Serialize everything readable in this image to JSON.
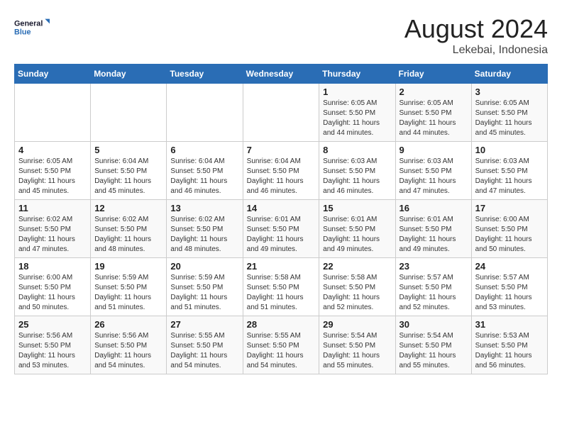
{
  "header": {
    "logo_line1": "General",
    "logo_line2": "Blue",
    "month": "August 2024",
    "location": "Lekebai, Indonesia"
  },
  "weekdays": [
    "Sunday",
    "Monday",
    "Tuesday",
    "Wednesday",
    "Thursday",
    "Friday",
    "Saturday"
  ],
  "weeks": [
    [
      {
        "day": "",
        "info": ""
      },
      {
        "day": "",
        "info": ""
      },
      {
        "day": "",
        "info": ""
      },
      {
        "day": "",
        "info": ""
      },
      {
        "day": "1",
        "info": "Sunrise: 6:05 AM\nSunset: 5:50 PM\nDaylight: 11 hours\nand 44 minutes."
      },
      {
        "day": "2",
        "info": "Sunrise: 6:05 AM\nSunset: 5:50 PM\nDaylight: 11 hours\nand 44 minutes."
      },
      {
        "day": "3",
        "info": "Sunrise: 6:05 AM\nSunset: 5:50 PM\nDaylight: 11 hours\nand 45 minutes."
      }
    ],
    [
      {
        "day": "4",
        "info": "Sunrise: 6:05 AM\nSunset: 5:50 PM\nDaylight: 11 hours\nand 45 minutes."
      },
      {
        "day": "5",
        "info": "Sunrise: 6:04 AM\nSunset: 5:50 PM\nDaylight: 11 hours\nand 45 minutes."
      },
      {
        "day": "6",
        "info": "Sunrise: 6:04 AM\nSunset: 5:50 PM\nDaylight: 11 hours\nand 46 minutes."
      },
      {
        "day": "7",
        "info": "Sunrise: 6:04 AM\nSunset: 5:50 PM\nDaylight: 11 hours\nand 46 minutes."
      },
      {
        "day": "8",
        "info": "Sunrise: 6:03 AM\nSunset: 5:50 PM\nDaylight: 11 hours\nand 46 minutes."
      },
      {
        "day": "9",
        "info": "Sunrise: 6:03 AM\nSunset: 5:50 PM\nDaylight: 11 hours\nand 47 minutes."
      },
      {
        "day": "10",
        "info": "Sunrise: 6:03 AM\nSunset: 5:50 PM\nDaylight: 11 hours\nand 47 minutes."
      }
    ],
    [
      {
        "day": "11",
        "info": "Sunrise: 6:02 AM\nSunset: 5:50 PM\nDaylight: 11 hours\nand 47 minutes."
      },
      {
        "day": "12",
        "info": "Sunrise: 6:02 AM\nSunset: 5:50 PM\nDaylight: 11 hours\nand 48 minutes."
      },
      {
        "day": "13",
        "info": "Sunrise: 6:02 AM\nSunset: 5:50 PM\nDaylight: 11 hours\nand 48 minutes."
      },
      {
        "day": "14",
        "info": "Sunrise: 6:01 AM\nSunset: 5:50 PM\nDaylight: 11 hours\nand 49 minutes."
      },
      {
        "day": "15",
        "info": "Sunrise: 6:01 AM\nSunset: 5:50 PM\nDaylight: 11 hours\nand 49 minutes."
      },
      {
        "day": "16",
        "info": "Sunrise: 6:01 AM\nSunset: 5:50 PM\nDaylight: 11 hours\nand 49 minutes."
      },
      {
        "day": "17",
        "info": "Sunrise: 6:00 AM\nSunset: 5:50 PM\nDaylight: 11 hours\nand 50 minutes."
      }
    ],
    [
      {
        "day": "18",
        "info": "Sunrise: 6:00 AM\nSunset: 5:50 PM\nDaylight: 11 hours\nand 50 minutes."
      },
      {
        "day": "19",
        "info": "Sunrise: 5:59 AM\nSunset: 5:50 PM\nDaylight: 11 hours\nand 51 minutes."
      },
      {
        "day": "20",
        "info": "Sunrise: 5:59 AM\nSunset: 5:50 PM\nDaylight: 11 hours\nand 51 minutes."
      },
      {
        "day": "21",
        "info": "Sunrise: 5:58 AM\nSunset: 5:50 PM\nDaylight: 11 hours\nand 51 minutes."
      },
      {
        "day": "22",
        "info": "Sunrise: 5:58 AM\nSunset: 5:50 PM\nDaylight: 11 hours\nand 52 minutes."
      },
      {
        "day": "23",
        "info": "Sunrise: 5:57 AM\nSunset: 5:50 PM\nDaylight: 11 hours\nand 52 minutes."
      },
      {
        "day": "24",
        "info": "Sunrise: 5:57 AM\nSunset: 5:50 PM\nDaylight: 11 hours\nand 53 minutes."
      }
    ],
    [
      {
        "day": "25",
        "info": "Sunrise: 5:56 AM\nSunset: 5:50 PM\nDaylight: 11 hours\nand 53 minutes."
      },
      {
        "day": "26",
        "info": "Sunrise: 5:56 AM\nSunset: 5:50 PM\nDaylight: 11 hours\nand 54 minutes."
      },
      {
        "day": "27",
        "info": "Sunrise: 5:55 AM\nSunset: 5:50 PM\nDaylight: 11 hours\nand 54 minutes."
      },
      {
        "day": "28",
        "info": "Sunrise: 5:55 AM\nSunset: 5:50 PM\nDaylight: 11 hours\nand 54 minutes."
      },
      {
        "day": "29",
        "info": "Sunrise: 5:54 AM\nSunset: 5:50 PM\nDaylight: 11 hours\nand 55 minutes."
      },
      {
        "day": "30",
        "info": "Sunrise: 5:54 AM\nSunset: 5:50 PM\nDaylight: 11 hours\nand 55 minutes."
      },
      {
        "day": "31",
        "info": "Sunrise: 5:53 AM\nSunset: 5:50 PM\nDaylight: 11 hours\nand 56 minutes."
      }
    ]
  ]
}
